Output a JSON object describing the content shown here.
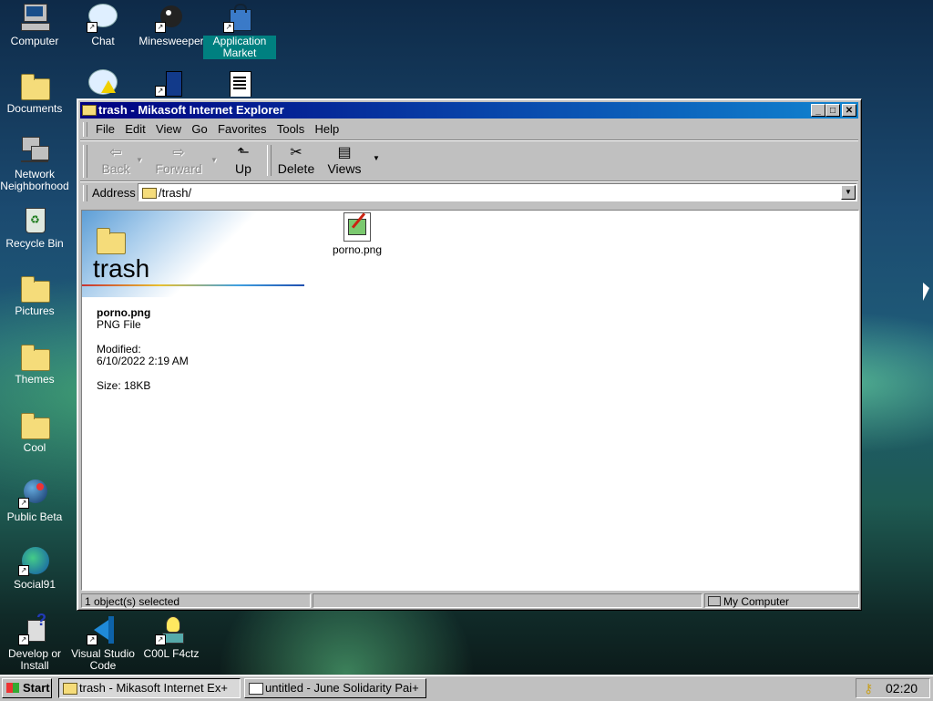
{
  "desktop": {
    "icons": [
      {
        "label": "Computer"
      },
      {
        "label": "Chat"
      },
      {
        "label": "Minesweeper"
      },
      {
        "label": "Application Market"
      },
      {
        "label": "Documents"
      },
      {
        "label": "Network Neighborhood"
      },
      {
        "label": "Recycle Bin"
      },
      {
        "label": "Pictures"
      },
      {
        "label": "Themes"
      },
      {
        "label": "Cool"
      },
      {
        "label": "Public Beta"
      },
      {
        "label": "Social91"
      },
      {
        "label": "Develop or Install"
      },
      {
        "label": "Visual Studio Code"
      },
      {
        "label": "C00L F4ctz"
      }
    ]
  },
  "window": {
    "title": "trash - Mikasoft Internet Explorer",
    "menu": [
      "File",
      "Edit",
      "View",
      "Go",
      "Favorites",
      "Tools",
      "Help"
    ],
    "toolbar": {
      "back": "Back",
      "forward": "Forward",
      "up": "Up",
      "delete": "Delete",
      "views": "Views"
    },
    "address": {
      "label": "Address",
      "value": "/trash/"
    },
    "folder": {
      "title": "trash",
      "selected_name": "porno.png",
      "selected_type": "PNG File",
      "modified_label": "Modified:",
      "modified_value": "6/10/2022 2:19 AM",
      "size": "Size: 18KB"
    },
    "files": [
      {
        "name": "porno.png"
      }
    ],
    "status": {
      "left": "1 object(s) selected",
      "right": "My Computer"
    }
  },
  "taskbar": {
    "start": "Start",
    "tasks": [
      "trash - Mikasoft Internet Ex+",
      "untitled - June Solidarity Pai+"
    ],
    "clock": "02:20"
  }
}
